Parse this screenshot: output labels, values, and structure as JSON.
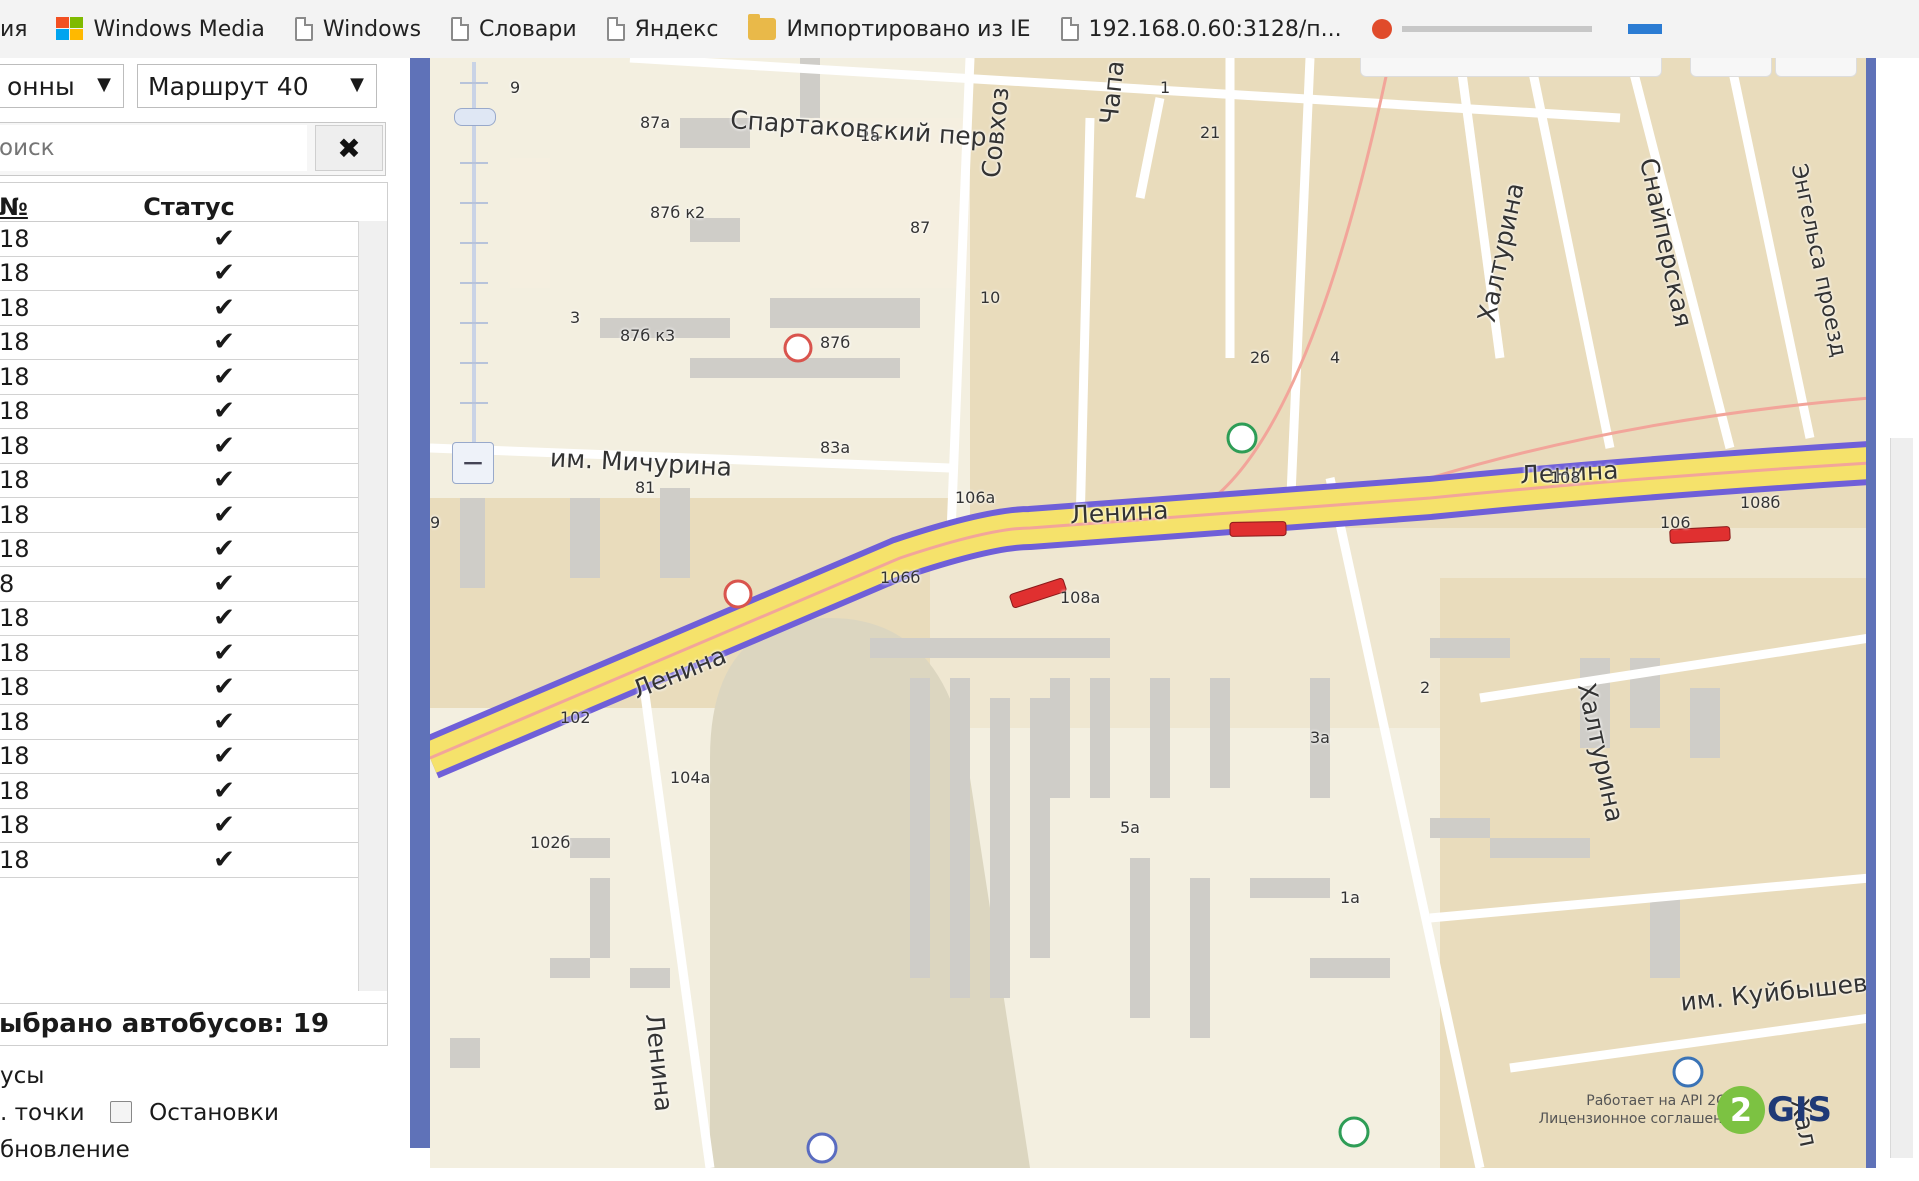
{
  "bookmarks": {
    "items": [
      {
        "label": "ия",
        "icon": "none"
      },
      {
        "label": "Windows Media",
        "icon": "windows-logo-icon"
      },
      {
        "label": "Windows",
        "icon": "page-icon"
      },
      {
        "label": "Словари",
        "icon": "page-icon"
      },
      {
        "label": "Яндекс",
        "icon": "page-icon"
      },
      {
        "label": "Импортировано из IE",
        "icon": "folder-icon"
      },
      {
        "label": "192.168.0.60:3128/п...",
        "icon": "page-icon"
      }
    ]
  },
  "filters": {
    "type_select": "онны",
    "route_select": "Маршрут 40",
    "search_placeholder": "оиск"
  },
  "table": {
    "headers": {
      "number": "№",
      "status": "Статус"
    },
    "rows": [
      {
        "number": "18",
        "status": "✔"
      },
      {
        "number": "18",
        "status": "✔"
      },
      {
        "number": "18",
        "status": "✔"
      },
      {
        "number": "18",
        "status": "✔"
      },
      {
        "number": "18",
        "status": "✔"
      },
      {
        "number": "18",
        "status": "✔"
      },
      {
        "number": "18",
        "status": "✔"
      },
      {
        "number": "18",
        "status": "✔"
      },
      {
        "number": "18",
        "status": "✔"
      },
      {
        "number": "18",
        "status": "✔"
      },
      {
        "number": "8",
        "status": "✔"
      },
      {
        "number": "18",
        "status": "✔"
      },
      {
        "number": "18",
        "status": "✔"
      },
      {
        "number": "18",
        "status": "✔"
      },
      {
        "number": "18",
        "status": "✔"
      },
      {
        "number": "18",
        "status": "✔"
      },
      {
        "number": "18",
        "status": "✔"
      },
      {
        "number": "18",
        "status": "✔"
      },
      {
        "number": "18",
        "status": "✔"
      }
    ]
  },
  "summary": {
    "selected_buses": "ыбрано автобусов: 19"
  },
  "options": {
    "buses": "усы",
    "points": ". точки",
    "stops": "Остановки",
    "update": "бновление"
  },
  "map": {
    "streets": {
      "spartakovsky": "Спартаковский пер",
      "michurina": "им. Мичурина",
      "lenina_1": "Ленина",
      "lenina_2": "Ленина",
      "lenina_3": "Ленина",
      "lenina_vertical": "Ленина",
      "haltrina_1": "Халтурина",
      "haltrina_2": "Халтурина",
      "haltrina_3": "Хал",
      "snayperskaya": "Снайперская",
      "engelsa": "Энгельса проезд",
      "sovhoz": "Совхоз",
      "chapa": "Чапа",
      "kuybysheva": "им. Куйбышев"
    },
    "house_numbers": [
      "9",
      "87а",
      "1а",
      "87б к2",
      "87",
      "3",
      "87б к3",
      "87б",
      "10",
      "83а",
      "81",
      "106а",
      "106б",
      "108а",
      "1",
      "21",
      "2б",
      "4",
      "108",
      "108б",
      "106",
      "2",
      "3а",
      "5а",
      "1а",
      "102",
      "104а",
      "102б",
      "9"
    ],
    "attribution": {
      "line1": "Работает на API 2GIS",
      "line2": "Лицензионное соглашение"
    },
    "logo": {
      "mark": "2",
      "text": "GIS"
    }
  },
  "colors": {
    "road_main": "#f4e24b",
    "route_line": "#7b6be0",
    "bus_marker": "#e03030",
    "map_bg": "#f3efe0",
    "block": "#e9dcbc"
  }
}
